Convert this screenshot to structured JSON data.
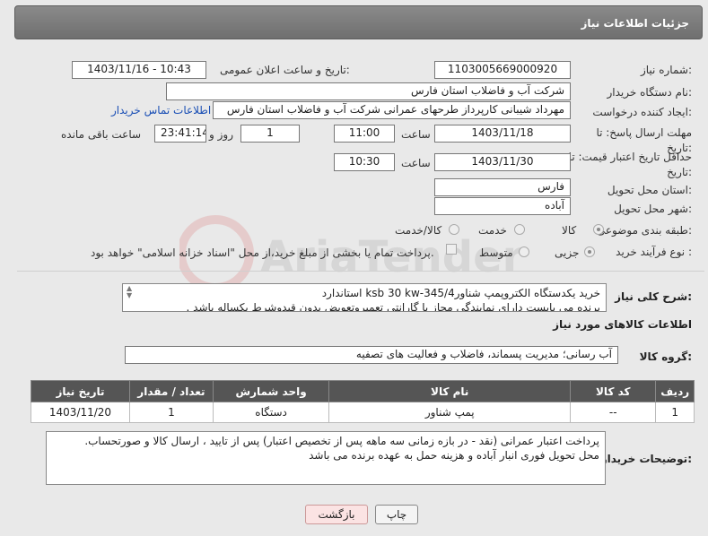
{
  "header": {
    "title": "جزئیات اطلاعات نیاز"
  },
  "form": {
    "need_number_label": "شماره نیاز:",
    "need_number": "1103005669000920",
    "announce_label": "تاریخ و ساعت اعلان عمومی:",
    "announce_value": "1403/11/16 - 10:43",
    "buyer_org_label": "نام دستگاه خریدار:",
    "buyer_org": "شرکت آب و فاضلاب استان فارس",
    "creator_label": "ایجاد کننده درخواست:",
    "creator": "مهرداد شیبانی کارپرداز طرحهای عمرانی  شرکت آب و فاضلاب استان فارس",
    "contact_link": "اطلاعات تماس خریدار",
    "deadline_label": "مهلت ارسال پاسخ: تا تاریخ:",
    "deadline_date": "1403/11/18",
    "time_label": "ساعت",
    "deadline_time": "11:00",
    "days_value": "1",
    "days_label": "روز و",
    "remaining_time": "23:41:14",
    "remaining_label": "ساعت باقی مانده",
    "validity_label": "حداقل تاریخ اعتبار قیمت: تا تاریخ:",
    "validity_date": "1403/11/30",
    "validity_time": "10:30",
    "province_label": "استان محل تحویل:",
    "province": "فارس",
    "city_label": "شهر محل تحویل:",
    "city": "آباده",
    "category_label": "طبقه بندی موضوعی:",
    "category_options": [
      "کالا",
      "خدمت",
      "کالا/خدمت"
    ],
    "process_label": "نوع فرآیند خرید :",
    "process_options": [
      "جزیی",
      "متوسط"
    ],
    "payment_note": "پرداخت تمام یا بخشی از مبلغ خرید،از محل \"اسناد خزانه اسلامی\" خواهد بود."
  },
  "summary": {
    "label": "شرح کلی نیاز:",
    "text_line1": "خرید یکدستگاه الکتروپمپ شناورksb 30 kw-345/4 استاندارد",
    "text_line2": "برنده می بایست دارای نمایندگی مجاز یا گارانتی  تعمیروتعویض بدون قیدوشرط یکساله باشد ."
  },
  "items_section": {
    "title": "اطلاعات کالاهای مورد نیاز",
    "group_label": "گروه کالا:",
    "group_value": "آب رسانی؛ مدیریت پسماند، فاضلاب و فعالیت های تصفیه"
  },
  "table": {
    "headers": [
      "ردیف",
      "کد کالا",
      "نام کالا",
      "واحد شمارش",
      "تعداد / مقدار",
      "تاریخ نیاز"
    ],
    "rows": [
      [
        "1",
        "--",
        "پمپ شناور",
        "دستگاه",
        "1",
        "1403/11/20"
      ]
    ]
  },
  "buyer_notes": {
    "label": "توضیحات خریدار:",
    "line1": "پرداخت اعتبار  عمرانی  (نقد - در بازه زمانی سه ماهه پس از تخصیص اعتبار) پس از تایید ، ارسال کالا  و صورتحساب.",
    "line2": "محل تحویل فوری انبار آباده و هزینه حمل به عهده برنده می باشد"
  },
  "buttons": {
    "print": "چاپ",
    "back": "بازگشت"
  },
  "watermark": "AriaTender.neT",
  "colors": {
    "header": "#7a7a7a",
    "table_header": "#555555",
    "link": "#1a4fb5"
  }
}
